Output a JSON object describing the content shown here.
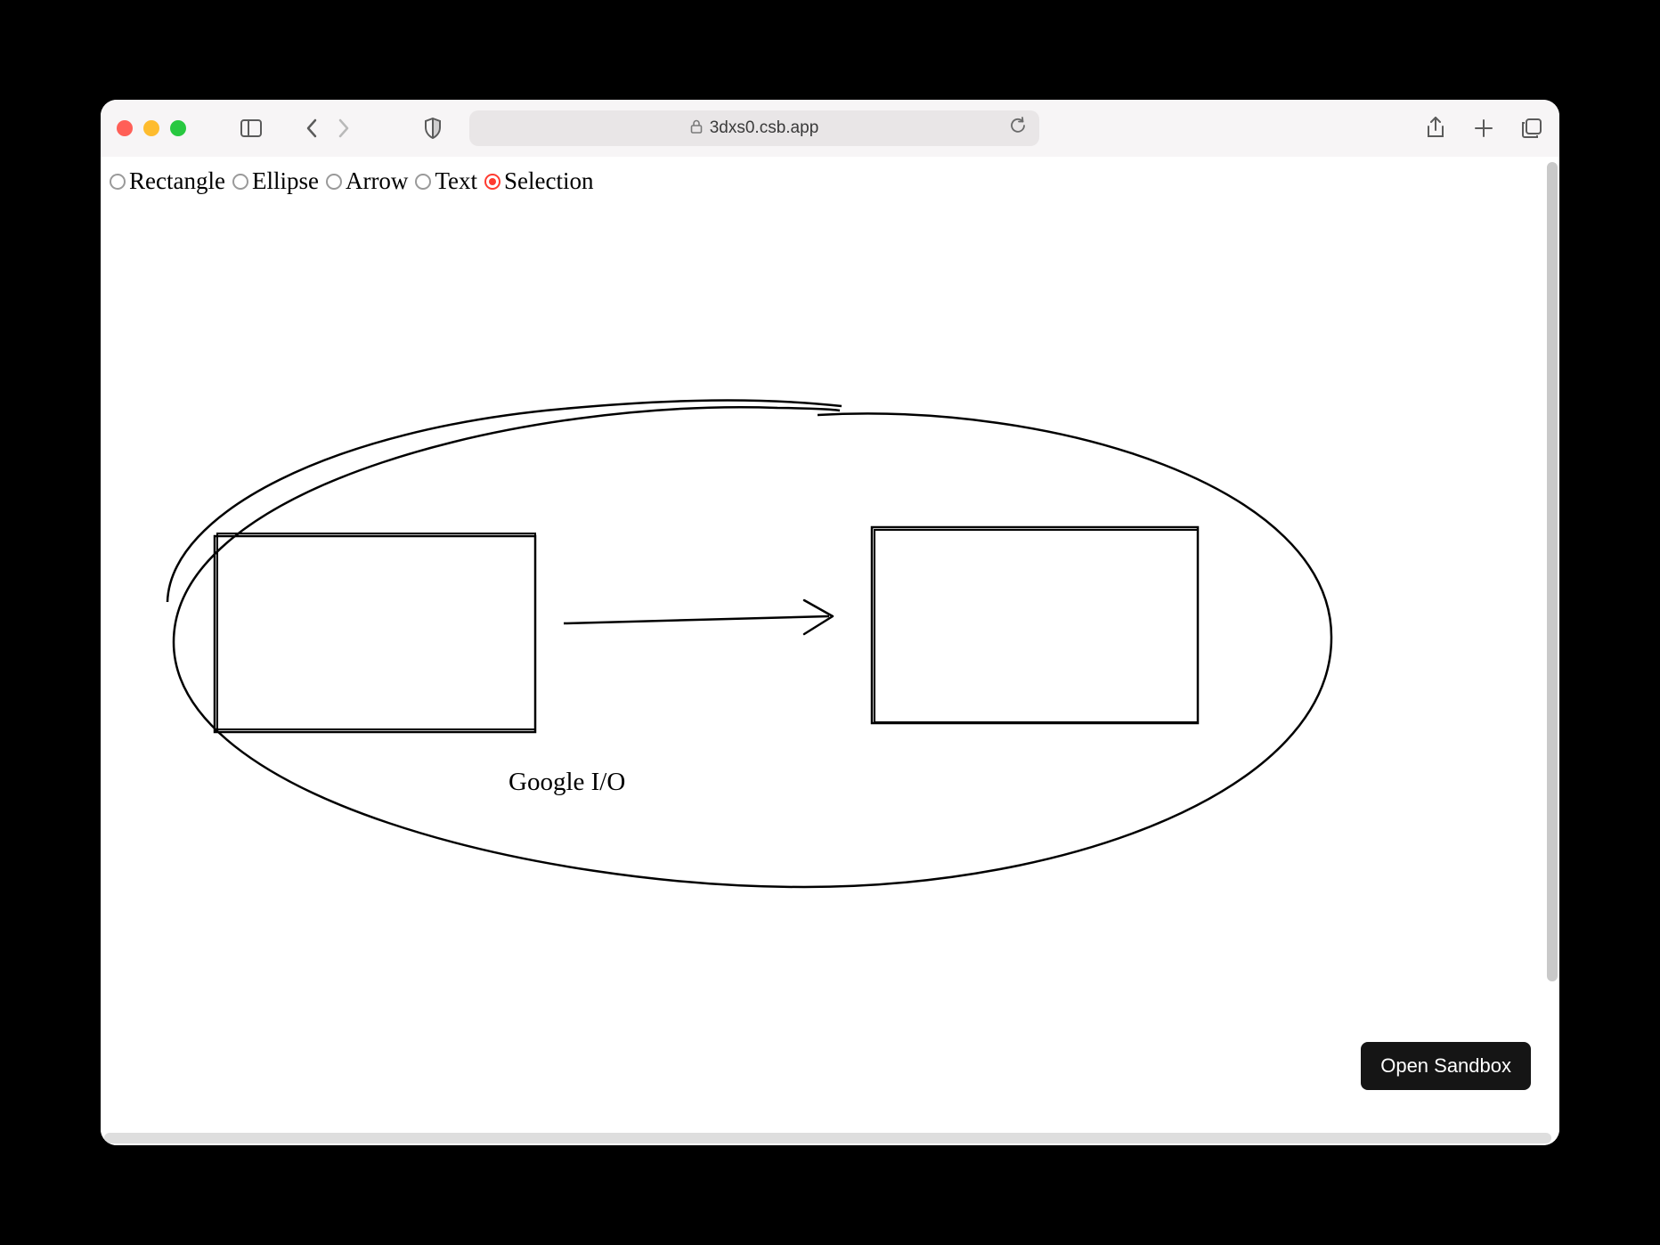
{
  "browser": {
    "url": "3dxs0.csb.app"
  },
  "toolbar": {
    "options": [
      {
        "label": "Rectangle",
        "checked": false
      },
      {
        "label": "Ellipse",
        "checked": false
      },
      {
        "label": "Arrow",
        "checked": false
      },
      {
        "label": "Text",
        "checked": false
      },
      {
        "label": "Selection",
        "checked": true
      }
    ]
  },
  "canvas": {
    "text_label": "Google I/O"
  },
  "actions": {
    "open_sandbox": "Open Sandbox"
  }
}
